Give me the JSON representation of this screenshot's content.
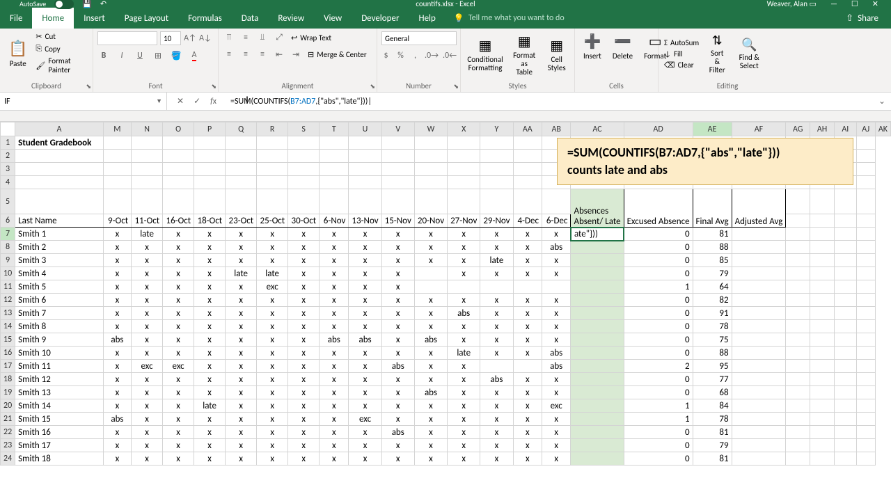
{
  "titlebar": {
    "autosave_label": "AutoSave",
    "filename": "countifs.xlsx - Excel",
    "username": "Weaver, Alan"
  },
  "tabs": {
    "file": "File",
    "home": "Home",
    "insert": "Insert",
    "page_layout": "Page Layout",
    "formulas": "Formulas",
    "data": "Data",
    "review": "Review",
    "view": "View",
    "developer": "Developer",
    "help": "Help",
    "tell_me": "Tell me what you want to do",
    "share": "Share"
  },
  "ribbon": {
    "clipboard": {
      "label": "Clipboard",
      "paste": "Paste",
      "cut": "Cut",
      "copy": "Copy",
      "format_painter": "Format Painter"
    },
    "font": {
      "label": "Font",
      "size": "10"
    },
    "alignment": {
      "label": "Alignment",
      "wrap": "Wrap Text",
      "merge": "Merge & Center"
    },
    "number": {
      "label": "Number",
      "format": "General"
    },
    "styles": {
      "label": "Styles",
      "cond": "Conditional Formatting",
      "table": "Format as Table",
      "cell": "Cell Styles"
    },
    "cells": {
      "label": "Cells",
      "insert": "Insert",
      "delete": "Delete",
      "format": "Format"
    },
    "editing": {
      "label": "Editing",
      "autosum": "AutoSum",
      "fill": "Fill",
      "clear": "Clear",
      "sort": "Sort & Filter",
      "find": "Find & Select"
    }
  },
  "namebox": "IF",
  "formula": {
    "prefix": "=SUM(COUNTIFS(",
    "ref": "B7:AD7",
    "suffix": ",{\"abs\",\"late\"}))"
  },
  "callout": {
    "line1": "=SUM(COUNTIFS(B7:AD7,{\"abs\",\"late\"}))",
    "line2": "counts late and abs"
  },
  "sheet_title": "Student Gradebook",
  "columns": [
    "A",
    "M",
    "N",
    "O",
    "P",
    "Q",
    "R",
    "S",
    "T",
    "U",
    "V",
    "W",
    "X",
    "Y",
    "AA",
    "AB",
    "AC",
    "AD",
    "AE",
    "AF",
    "AG",
    "AH",
    "AI",
    "AJ",
    "AK"
  ],
  "date_headers": [
    "9-Oct",
    "11-Oct",
    "16-Oct",
    "18-Oct",
    "23-Oct",
    "25-Oct",
    "30-Oct",
    "6-Nov",
    "13-Nov",
    "15-Nov",
    "20-Nov",
    "27-Nov",
    "29-Nov",
    "4-Dec",
    "6-Dec"
  ],
  "summary_headers": {
    "absences": "Absences",
    "absent_late": "Absent/ Late",
    "excused": "Excused Absence",
    "final_avg": "Final Avg",
    "adjusted_avg": "Adjusted Avg"
  },
  "editing_cell_display": "ate\"}))",
  "rows": [
    {
      "n": 7,
      "name": "Smith 1",
      "c": [
        "x",
        "late",
        "x",
        "x",
        "x",
        "x",
        "x",
        "x",
        "x",
        "x",
        "x",
        "x",
        "x",
        "x",
        "x"
      ],
      "ex": 0,
      "avg": 81
    },
    {
      "n": 8,
      "name": "Smith 2",
      "c": [
        "x",
        "x",
        "x",
        "x",
        "x",
        "x",
        "x",
        "x",
        "x",
        "x",
        "x",
        "x",
        "x",
        "x",
        "abs"
      ],
      "ex": 0,
      "avg": 88
    },
    {
      "n": 9,
      "name": "Smith 3",
      "c": [
        "x",
        "x",
        "x",
        "x",
        "x",
        "x",
        "x",
        "x",
        "x",
        "x",
        "x",
        "x",
        "late",
        "x",
        "x"
      ],
      "ex": 0,
      "avg": 85
    },
    {
      "n": 10,
      "name": "Smith 4",
      "c": [
        "x",
        "x",
        "x",
        "x",
        "late",
        "late",
        "x",
        "x",
        "x",
        "x",
        "",
        "x",
        "x",
        "x",
        "x"
      ],
      "ex": 0,
      "avg": 79
    },
    {
      "n": 11,
      "name": "Smith 5",
      "c": [
        "x",
        "x",
        "x",
        "x",
        "x",
        "exc",
        "x",
        "x",
        "x",
        "x",
        "",
        "",
        "",
        "",
        ""
      ],
      "ex": 1,
      "avg": 64
    },
    {
      "n": 12,
      "name": "Smith 6",
      "c": [
        "x",
        "x",
        "x",
        "x",
        "x",
        "x",
        "x",
        "x",
        "x",
        "x",
        "x",
        "x",
        "x",
        "x",
        "x"
      ],
      "ex": 0,
      "avg": 82
    },
    {
      "n": 13,
      "name": "Smith 7",
      "c": [
        "x",
        "x",
        "x",
        "x",
        "x",
        "x",
        "x",
        "x",
        "x",
        "x",
        "x",
        "abs",
        "x",
        "x",
        "x"
      ],
      "ex": 0,
      "avg": 91
    },
    {
      "n": 14,
      "name": "Smith 8",
      "c": [
        "x",
        "x",
        "x",
        "x",
        "x",
        "x",
        "x",
        "x",
        "x",
        "x",
        "x",
        "x",
        "x",
        "x",
        "x"
      ],
      "ex": 0,
      "avg": 78
    },
    {
      "n": 15,
      "name": "Smith 9",
      "c": [
        "abs",
        "x",
        "x",
        "x",
        "x",
        "x",
        "x",
        "abs",
        "abs",
        "x",
        "abs",
        "x",
        "x",
        "x",
        "x"
      ],
      "ex": 0,
      "avg": 75
    },
    {
      "n": 16,
      "name": "Smith 10",
      "c": [
        "x",
        "x",
        "x",
        "x",
        "x",
        "x",
        "x",
        "x",
        "x",
        "x",
        "x",
        "late",
        "x",
        "x",
        "abs"
      ],
      "ex": 0,
      "avg": 88
    },
    {
      "n": 17,
      "name": "Smith 11",
      "c": [
        "x",
        "exc",
        "exc",
        "x",
        "x",
        "x",
        "x",
        "x",
        "x",
        "abs",
        "x",
        "x",
        "",
        "",
        "abs"
      ],
      "ex": 2,
      "avg": 95
    },
    {
      "n": 18,
      "name": "Smith 12",
      "c": [
        "x",
        "x",
        "x",
        "x",
        "x",
        "x",
        "x",
        "x",
        "x",
        "x",
        "x",
        "x",
        "abs",
        "x",
        "x"
      ],
      "ex": 0,
      "avg": 77
    },
    {
      "n": 19,
      "name": "Smith 13",
      "c": [
        "x",
        "x",
        "x",
        "x",
        "x",
        "x",
        "x",
        "x",
        "x",
        "x",
        "abs",
        "x",
        "x",
        "x",
        "x"
      ],
      "ex": 0,
      "avg": 68
    },
    {
      "n": 20,
      "name": "Smith 14",
      "c": [
        "x",
        "x",
        "x",
        "late",
        "x",
        "x",
        "x",
        "x",
        "x",
        "x",
        "x",
        "x",
        "x",
        "x",
        "exc"
      ],
      "ex": 1,
      "avg": 84
    },
    {
      "n": 21,
      "name": "Smith 15",
      "c": [
        "abs",
        "x",
        "x",
        "x",
        "x",
        "x",
        "x",
        "x",
        "exc",
        "x",
        "x",
        "x",
        "x",
        "x",
        "x"
      ],
      "ex": 1,
      "avg": 78
    },
    {
      "n": 22,
      "name": "Smith 16",
      "c": [
        "x",
        "x",
        "x",
        "x",
        "x",
        "x",
        "x",
        "x",
        "x",
        "abs",
        "x",
        "x",
        "x",
        "x",
        "x"
      ],
      "ex": 0,
      "avg": 81
    },
    {
      "n": 23,
      "name": "Smith 17",
      "c": [
        "x",
        "x",
        "x",
        "x",
        "x",
        "x",
        "x",
        "x",
        "x",
        "x",
        "x",
        "x",
        "x",
        "x",
        "x"
      ],
      "ex": 0,
      "avg": 79
    },
    {
      "n": 24,
      "name": "Smith 18",
      "c": [
        "x",
        "x",
        "x",
        "x",
        "x",
        "x",
        "x",
        "x",
        "x",
        "x",
        "x",
        "x",
        "x",
        "x",
        "x"
      ],
      "ex": 0,
      "avg": 81
    }
  ]
}
